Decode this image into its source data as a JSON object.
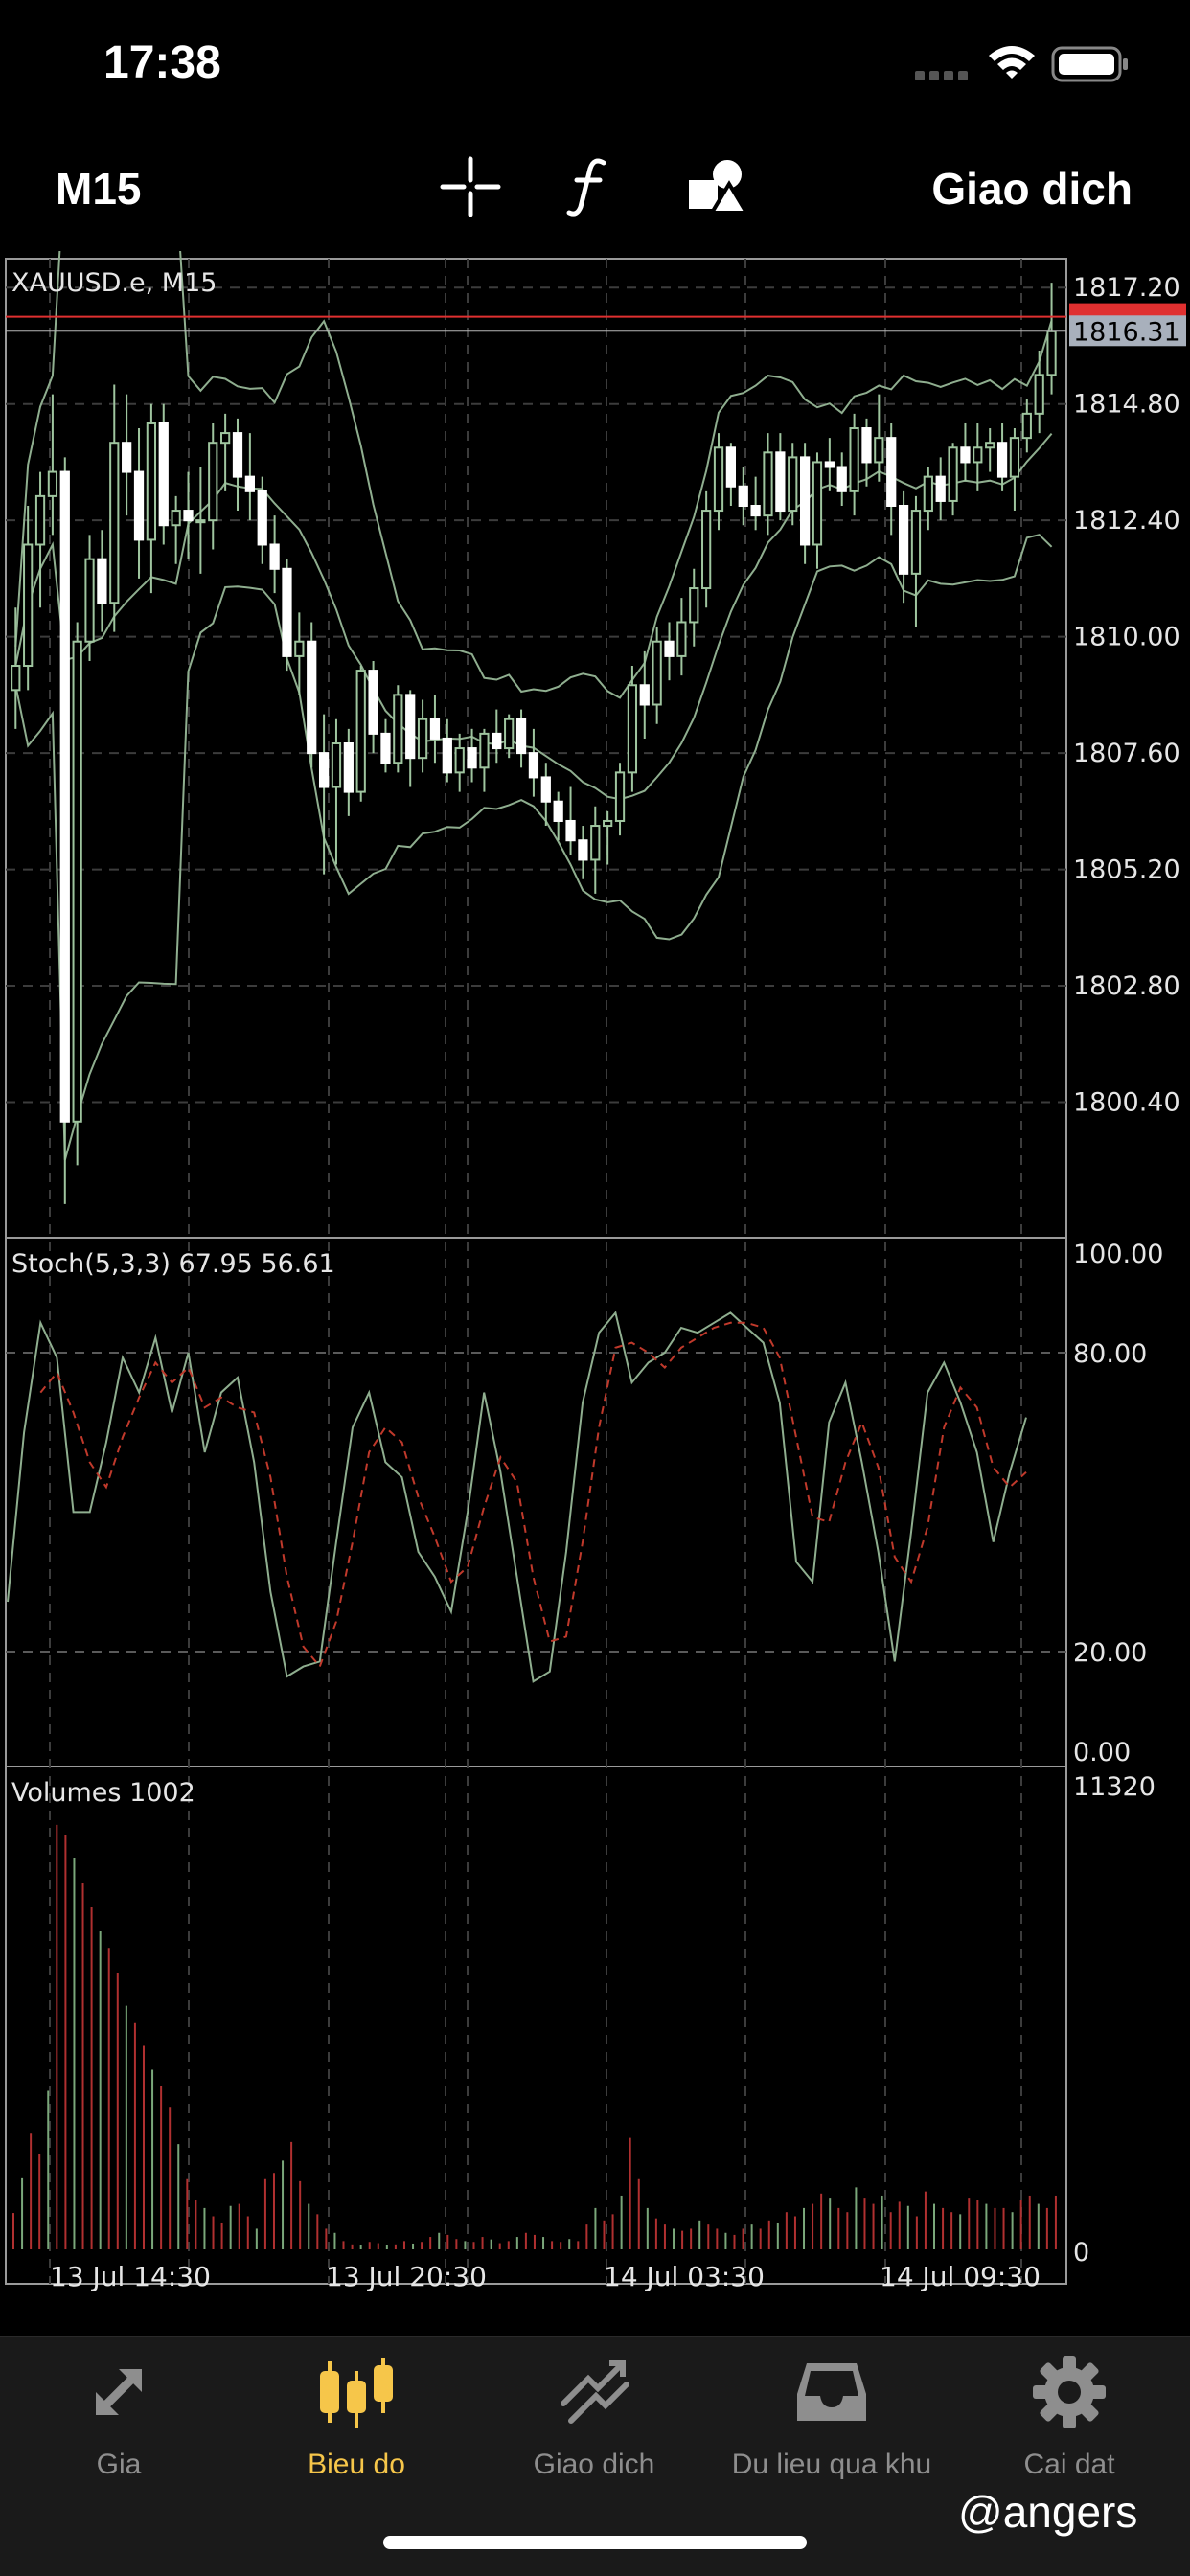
{
  "status": {
    "time": "17:38"
  },
  "toolbar": {
    "timeframe": "M15",
    "trade_label": "Giao dich"
  },
  "chart_data": {
    "type": "candlestick",
    "symbol_label": "XAUUSD.e, M15",
    "price_axis": {
      "ticks": [
        "1817.20",
        "1814.80",
        "1812.40",
        "1810.00",
        "1807.60",
        "1805.20",
        "1802.80",
        "1800.40"
      ],
      "min": 1798.0,
      "max": 1817.6
    },
    "current_price": "1816.31",
    "ask_line": 1816.6,
    "candles": [
      [
        1808.9,
        1810.6,
        1808.1,
        1809.4
      ],
      [
        1809.4,
        1812.7,
        1808.9,
        1811.9
      ],
      [
        1811.9,
        1813.4,
        1810.6,
        1812.9
      ],
      [
        1812.9,
        1815.0,
        1812.1,
        1813.4
      ],
      [
        1813.4,
        1813.7,
        1798.3,
        1800.0
      ],
      [
        1800.0,
        1810.3,
        1799.1,
        1809.9
      ],
      [
        1809.9,
        1812.1,
        1809.5,
        1811.6
      ],
      [
        1811.6,
        1812.2,
        1810.1,
        1810.7
      ],
      [
        1810.7,
        1815.2,
        1810.1,
        1814.0
      ],
      [
        1814.0,
        1815.0,
        1812.5,
        1813.4
      ],
      [
        1813.4,
        1814.3,
        1811.2,
        1812.0
      ],
      [
        1812.0,
        1814.8,
        1810.9,
        1814.4
      ],
      [
        1814.4,
        1814.8,
        1811.9,
        1812.3
      ],
      [
        1812.3,
        1812.9,
        1811.5,
        1812.6
      ],
      [
        1812.6,
        1813.4,
        1811.6,
        1812.4
      ],
      [
        1812.4,
        1813.5,
        1811.3,
        1812.4
      ],
      [
        1812.4,
        1814.4,
        1811.8,
        1814.0
      ],
      [
        1814.0,
        1814.6,
        1813.0,
        1814.2
      ],
      [
        1814.2,
        1814.5,
        1812.6,
        1813.3
      ],
      [
        1813.3,
        1814.2,
        1812.4,
        1813.0
      ],
      [
        1813.0,
        1813.3,
        1811.5,
        1811.9
      ],
      [
        1811.9,
        1812.5,
        1810.9,
        1811.4
      ],
      [
        1811.4,
        1811.6,
        1809.3,
        1809.6
      ],
      [
        1809.6,
        1810.5,
        1808.8,
        1809.9
      ],
      [
        1809.9,
        1810.3,
        1807.3,
        1807.6
      ],
      [
        1807.6,
        1808.4,
        1805.1,
        1806.9
      ],
      [
        1806.9,
        1808.3,
        1805.3,
        1807.8
      ],
      [
        1807.8,
        1808.1,
        1806.3,
        1806.8
      ],
      [
        1806.8,
        1809.4,
        1806.6,
        1809.3
      ],
      [
        1809.3,
        1809.5,
        1807.6,
        1808.0
      ],
      [
        1808.0,
        1808.3,
        1807.2,
        1807.4
      ],
      [
        1807.4,
        1809.0,
        1807.2,
        1808.8
      ],
      [
        1808.8,
        1808.9,
        1806.9,
        1807.5
      ],
      [
        1807.5,
        1808.7,
        1807.2,
        1808.3
      ],
      [
        1808.3,
        1808.8,
        1807.4,
        1807.9
      ],
      [
        1807.9,
        1808.3,
        1807.0,
        1807.2
      ],
      [
        1807.2,
        1808.0,
        1806.8,
        1807.7
      ],
      [
        1807.7,
        1808.1,
        1807.0,
        1807.3
      ],
      [
        1807.3,
        1808.1,
        1806.8,
        1808.0
      ],
      [
        1808.0,
        1808.5,
        1807.4,
        1807.7
      ],
      [
        1807.7,
        1808.4,
        1807.5,
        1808.3
      ],
      [
        1808.3,
        1808.5,
        1807.3,
        1807.6
      ],
      [
        1807.6,
        1808.1,
        1806.7,
        1807.1
      ],
      [
        1807.1,
        1807.4,
        1806.1,
        1806.6
      ],
      [
        1806.6,
        1806.8,
        1805.8,
        1806.2
      ],
      [
        1806.2,
        1806.9,
        1805.5,
        1805.8
      ],
      [
        1805.8,
        1806.1,
        1805.0,
        1805.4
      ],
      [
        1805.4,
        1806.5,
        1804.7,
        1806.1
      ],
      [
        1806.1,
        1806.4,
        1805.3,
        1806.2
      ],
      [
        1806.2,
        1807.4,
        1805.9,
        1807.2
      ],
      [
        1807.2,
        1809.4,
        1806.8,
        1809.0
      ],
      [
        1809.0,
        1809.7,
        1807.9,
        1808.6
      ],
      [
        1808.6,
        1810.2,
        1808.2,
        1809.9
      ],
      [
        1809.9,
        1810.3,
        1809.1,
        1809.6
      ],
      [
        1809.6,
        1810.8,
        1809.2,
        1810.3
      ],
      [
        1810.3,
        1811.4,
        1809.8,
        1811.0
      ],
      [
        1811.0,
        1813.0,
        1810.6,
        1812.6
      ],
      [
        1812.6,
        1814.2,
        1812.2,
        1813.9
      ],
      [
        1813.9,
        1814.0,
        1812.7,
        1813.1
      ],
      [
        1813.1,
        1813.5,
        1812.3,
        1812.7
      ],
      [
        1812.7,
        1813.3,
        1812.2,
        1812.5
      ],
      [
        1812.5,
        1814.2,
        1812.1,
        1813.8
      ],
      [
        1813.8,
        1814.2,
        1812.4,
        1812.6
      ],
      [
        1812.6,
        1814.0,
        1812.3,
        1813.7
      ],
      [
        1813.7,
        1814.0,
        1811.5,
        1811.9
      ],
      [
        1811.9,
        1813.8,
        1811.4,
        1813.6
      ],
      [
        1813.6,
        1814.1,
        1813.0,
        1813.5
      ],
      [
        1813.5,
        1813.8,
        1812.7,
        1813.0
      ],
      [
        1813.0,
        1814.6,
        1812.5,
        1814.3
      ],
      [
        1814.3,
        1814.5,
        1813.1,
        1813.6
      ],
      [
        1813.6,
        1815.0,
        1813.2,
        1814.1
      ],
      [
        1814.1,
        1814.4,
        1812.1,
        1812.7
      ],
      [
        1812.7,
        1813.0,
        1810.7,
        1811.3
      ],
      [
        1811.3,
        1812.9,
        1810.2,
        1812.6
      ],
      [
        1812.6,
        1813.5,
        1812.2,
        1813.3
      ],
      [
        1813.3,
        1813.7,
        1812.4,
        1812.8
      ],
      [
        1812.8,
        1814.0,
        1812.5,
        1813.9
      ],
      [
        1813.9,
        1814.4,
        1813.2,
        1813.6
      ],
      [
        1813.6,
        1814.4,
        1813.0,
        1813.9
      ],
      [
        1813.9,
        1814.3,
        1813.4,
        1814.0
      ],
      [
        1814.0,
        1814.4,
        1813.0,
        1813.3
      ],
      [
        1813.3,
        1814.3,
        1812.6,
        1814.1
      ],
      [
        1814.1,
        1814.9,
        1813.8,
        1814.6
      ],
      [
        1814.6,
        1815.9,
        1814.2,
        1815.4
      ],
      [
        1815.4,
        1817.3,
        1815.0,
        1816.3
      ]
    ],
    "stoch": {
      "label": "Stoch(5,3,3) 67.95 56.61",
      "ticks": [
        "100.00",
        "80.00",
        "20.00",
        "0.00"
      ],
      "levels": [
        80,
        20
      ],
      "k": [
        30,
        64,
        86,
        79,
        48,
        48,
        62,
        79,
        72,
        83,
        68,
        80,
        60,
        72,
        75,
        58,
        32,
        15,
        17,
        18,
        42,
        65,
        72,
        58,
        55,
        40,
        35,
        28,
        48,
        72,
        56,
        35,
        14,
        16,
        40,
        70,
        84,
        88,
        74,
        78,
        80,
        85,
        84,
        86,
        88,
        85,
        82,
        70,
        38,
        34,
        66,
        74,
        58,
        40,
        18,
        44,
        72,
        78,
        70,
        60,
        42,
        56,
        67
      ],
      "d": [
        null,
        null,
        72,
        76,
        68,
        58,
        53,
        63,
        71,
        78,
        74,
        77,
        69,
        71,
        69,
        68,
        55,
        35,
        21,
        17,
        26,
        42,
        60,
        65,
        62,
        51,
        43,
        34,
        37,
        49,
        59,
        54,
        35,
        22,
        23,
        42,
        65,
        81,
        82,
        80,
        77,
        81,
        83,
        85,
        86,
        86,
        85,
        79,
        63,
        47,
        46,
        58,
        66,
        57,
        39,
        34,
        45,
        65,
        73,
        69,
        57,
        53,
        56
      ]
    },
    "volumes": {
      "label": "Volumes 1002",
      "ticks": [
        "11320",
        "0"
      ],
      "max": 11320,
      "values": [
        880,
        1720,
        2800,
        2310,
        3840,
        10280,
        10040,
        9470,
        8860,
        8280,
        7700,
        7300,
        6680,
        5900,
        5480,
        4930,
        4350,
        3950,
        3450,
        2550,
        1700,
        1200,
        1000,
        800,
        650,
        1050,
        1100,
        800,
        500,
        1700,
        1850,
        2150,
        2600,
        1650,
        1100,
        850,
        500,
        400,
        200,
        120,
        100,
        180,
        150,
        100,
        120,
        200,
        140,
        180,
        300,
        400,
        350,
        250,
        200,
        180,
        300,
        240,
        150,
        200,
        300,
        400,
        350,
        300,
        200,
        180,
        250,
        200,
        600,
        1000,
        700,
        850,
        1300,
        2700,
        1700,
        1000,
        750,
        600,
        500,
        450,
        500,
        700,
        600,
        500,
        400,
        350,
        500,
        600,
        500,
        700,
        650,
        900,
        800,
        1000,
        1100,
        1350,
        1250,
        1000,
        900,
        1500,
        1250,
        1100,
        1300,
        900,
        1150,
        1050,
        800,
        1400,
        1100,
        1000,
        900,
        850,
        1250,
        1200,
        1100,
        1000,
        1000,
        900,
        1200,
        1300,
        1100,
        1000,
        1300
      ]
    },
    "time_axis": {
      "ticks": [
        "13 Jul 14:30",
        "13 Jul 20:30",
        "14 Jul 03:30",
        "14 Jul 09:30"
      ]
    }
  },
  "tabs": [
    {
      "label": "Gia"
    },
    {
      "label": "Bieu do"
    },
    {
      "label": "Giao dich"
    },
    {
      "label": "Du lieu qua khu"
    },
    {
      "label": "Cai dat"
    }
  ],
  "watermark": "@angers"
}
